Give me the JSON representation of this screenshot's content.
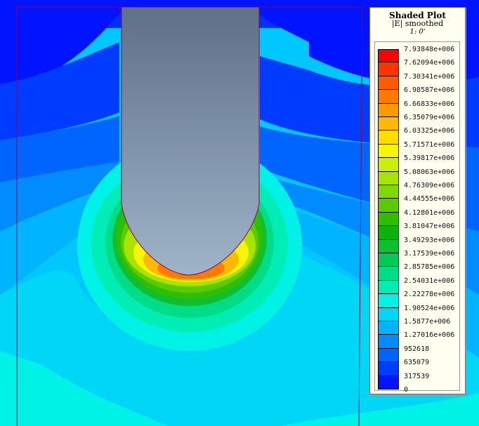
{
  "legend": {
    "title": "Shaded Plot",
    "quantity": "|E|",
    "mode": "smoothed",
    "time": "1: 0'",
    "ticks": [
      "7.93848e+006",
      "7.62094e+006",
      "7.30341e+006",
      "6.98587e+006",
      "6.66833e+006",
      "6.35079e+006",
      "6.03325e+006",
      "5.71571e+006",
      "5.39817e+006",
      "5.08063e+006",
      "4.76309e+006",
      "4.44555e+006",
      "4.12801e+006",
      "3.81047e+006",
      "3.49293e+006",
      "3.17539e+006",
      "2.85785e+006",
      "2.54031e+006",
      "2.22278e+006",
      "1.90524e+006",
      "1.5877e+006",
      "1.27016e+006",
      "952618",
      "635079",
      "317539",
      "0"
    ],
    "colors": [
      "#ff0000",
      "#ff3300",
      "#ff5a00",
      "#ff7a00",
      "#ff9900",
      "#ffba00",
      "#ffdd00",
      "#f6f600",
      "#cdef00",
      "#a8e400",
      "#80d800",
      "#58cc00",
      "#2ec000",
      "#0ab40a",
      "#10bf30",
      "#00cc55",
      "#00dd88",
      "#00eeb5",
      "#00f2e6",
      "#00d6f5",
      "#00b4ff",
      "#008cff",
      "#0064ff",
      "#003cff",
      "#0014ff"
    ]
  },
  "plot": {
    "field_colors": [
      "#0014ff",
      "#003cff",
      "#0064ff",
      "#008cff",
      "#00b4ff",
      "#00d6f5",
      "#00f2e6",
      "#00eeb5",
      "#00dd88",
      "#10bf30",
      "#2ec000",
      "#58cc00",
      "#a8e400",
      "#f6f600",
      "#ffba00",
      "#ff7a00"
    ],
    "electrode_color": "#8a9cb2",
    "boundary_color": "#9a0044"
  }
}
